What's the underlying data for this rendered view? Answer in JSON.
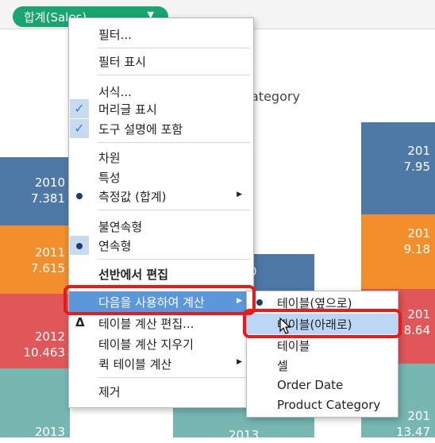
{
  "pill": {
    "label": "합계(Sales)",
    "arrow": "▼"
  },
  "axis_title": "ategory",
  "bars": [
    {
      "col": "left",
      "segs": [
        {
          "color": "#4e79a7",
          "l1": "2010",
          "l2": "7.381"
        },
        {
          "color": "#f28e2b",
          "l1": "2011",
          "l2": "7.615"
        },
        {
          "color": "#e15759",
          "l1": "2012",
          "l2": "10.463"
        },
        {
          "color": "#76b7b2",
          "l1": "2013",
          "l2": ""
        }
      ]
    },
    {
      "col": "middle",
      "segs": [
        {
          "color": "#4e79a7",
          "l1": "0",
          "l2": ""
        },
        {
          "color": "#76b7b2",
          "l1": "2013",
          "l2": ""
        }
      ]
    },
    {
      "col": "right",
      "segs": [
        {
          "color": "#4e79a7",
          "l1": "201",
          "l2": "7.95"
        },
        {
          "color": "#f28e2b",
          "l1": "201",
          "l2": "9.18"
        },
        {
          "color": "#e15759",
          "l1": "201",
          "l2": "8.64"
        },
        {
          "color": "#76b7b2",
          "l1": "201",
          "l2": "13.47"
        }
      ]
    }
  ],
  "menu": {
    "filter": "필터...",
    "show_filter": "필터 표시",
    "format": "서식...",
    "show_header": "머리글 표시",
    "include_tooltip": "도구 설명에 포함",
    "dimension": "차원",
    "attribute": "특성",
    "measure": "측정값 (합계)",
    "discrete": "불연속형",
    "continuous": "연속형",
    "edit_in_shelf": "선반에서 편집",
    "compute_using": "다음을 사용하여 계산",
    "edit_table_calc": "테이블 계산 편집...",
    "clear_table_calc": "테이블 계산 지우기",
    "quick_table_calc": "퀵 테이블 계산",
    "remove": "제거",
    "check_glyph": "✓",
    "submenu_arrow": "▶",
    "calc_icon": "Δ"
  },
  "submenu": {
    "table_across": "테이블(옆으로)",
    "table_down": "테이블(아래로)",
    "table": "테이블",
    "cell": "셀",
    "order_date": "Order Date",
    "product_category": "Product Category"
  },
  "colors": {
    "accent_green": "#18a56f",
    "highlight_blue": "#5b97db",
    "annotation_red": "#ea1a1a"
  }
}
